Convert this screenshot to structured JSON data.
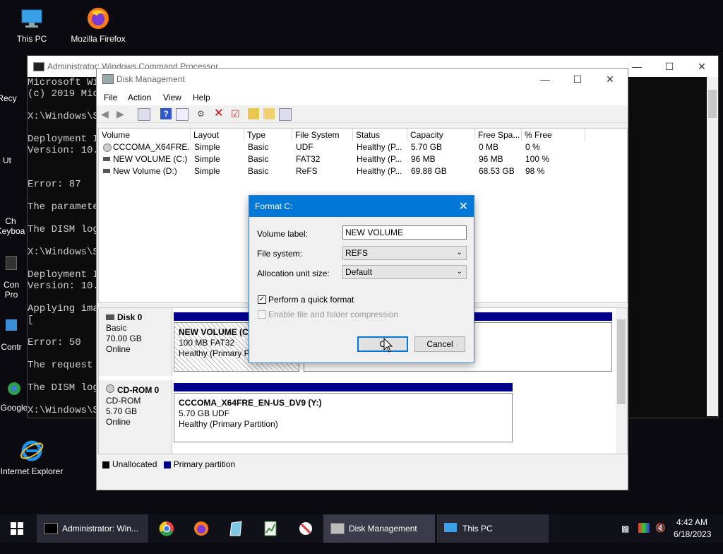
{
  "desktop": {
    "icons": [
      {
        "label": "This PC",
        "icon": "pc-icon"
      },
      {
        "label": "Mozilla Firefox",
        "icon": "firefox-icon"
      },
      {
        "label": "Recy",
        "icon": "recycle-bin-icon"
      },
      {
        "label": "Ut",
        "icon": "utility-icon"
      },
      {
        "label": "Ch Keyboa",
        "icon": "keyboard-icon"
      },
      {
        "label": "Con Pro",
        "icon": "console-icon"
      },
      {
        "label": "Contr",
        "icon": "control-panel-icon"
      },
      {
        "label": "Google",
        "icon": "chrome-icon"
      },
      {
        "label": "Internet Explorer",
        "icon": "ie-icon"
      }
    ]
  },
  "cmd": {
    "title": "Administrator: Windows Command Processor",
    "lines": [
      "Microsoft Wi",
      "(c) 2019 Mic",
      "",
      "X:\\Windows\\S",
      "",
      "Deployment I",
      "Version: 10.",
      "",
      "",
      "Error: 87",
      "",
      "The paramete",
      "",
      "The DISM log",
      "",
      "X:\\Windows\\S",
      "",
      "Deployment I",
      "Version: 10.",
      "",
      "Applying ima",
      "[",
      "",
      "Error: 50",
      "",
      "The request",
      "",
      "The DISM log",
      "",
      "X:\\Windows\\S"
    ]
  },
  "diskmgmt": {
    "title": "Disk Management",
    "menu": [
      "File",
      "Action",
      "View",
      "Help"
    ],
    "columns": [
      "Volume",
      "Layout",
      "Type",
      "File System",
      "Status",
      "Capacity",
      "Free Spa...",
      "% Free"
    ],
    "rows": [
      [
        "CCCOMA_X64FRE...",
        "Simple",
        "Basic",
        "UDF",
        "Healthy (P...",
        "5.70 GB",
        "0 MB",
        "0 %"
      ],
      [
        "NEW VOLUME (C:)",
        "Simple",
        "Basic",
        "FAT32",
        "Healthy (P...",
        "96 MB",
        "96 MB",
        "100 %"
      ],
      [
        "New Volume (D:)",
        "Simple",
        "Basic",
        "ReFS",
        "Healthy (P...",
        "69.88 GB",
        "68.53 GB",
        "98 %"
      ]
    ],
    "disks": [
      {
        "name": "Disk 0",
        "type": "Basic",
        "size": "70.00 GB",
        "state": "Online",
        "partition": {
          "name": "NEW VOLUME  (C:)",
          "detail": "100 MB FAT32",
          "status": "Healthy (Primary Pa"
        }
      },
      {
        "name": "CD-ROM 0",
        "type": "CD-ROM",
        "size": "5.70 GB",
        "state": "Online",
        "partition": {
          "name": "CCCOMA_X64FRE_EN-US_DV9  (Y:)",
          "detail": "5.70 GB UDF",
          "status": "Healthy (Primary Partition)"
        }
      }
    ],
    "legend": {
      "unallocated": "Unallocated",
      "primary": "Primary partition"
    }
  },
  "dialog": {
    "title": "Format C:",
    "volume_label_text": "Volume label:",
    "volume_label_value": "NEW VOLUME",
    "fs_text": "File system:",
    "fs_value": "REFS",
    "alloc_text": "Allocation unit size:",
    "alloc_value": "Default",
    "quick_format": "Perform a quick format",
    "quick_format_checked": true,
    "compression": "Enable file and folder compression",
    "compression_checked": false,
    "ok": "OK",
    "ok_visible": "O",
    "cancel": "Cancel"
  },
  "taskbar": {
    "items": [
      {
        "label": "Administrator: Win...",
        "icon": "cmd-icon"
      },
      {
        "label": "Disk Management",
        "icon": "disk-management-icon"
      },
      {
        "label": "This PC",
        "icon": "pc-icon"
      }
    ],
    "time": "4:42 AM",
    "date": "6/18/2023"
  }
}
